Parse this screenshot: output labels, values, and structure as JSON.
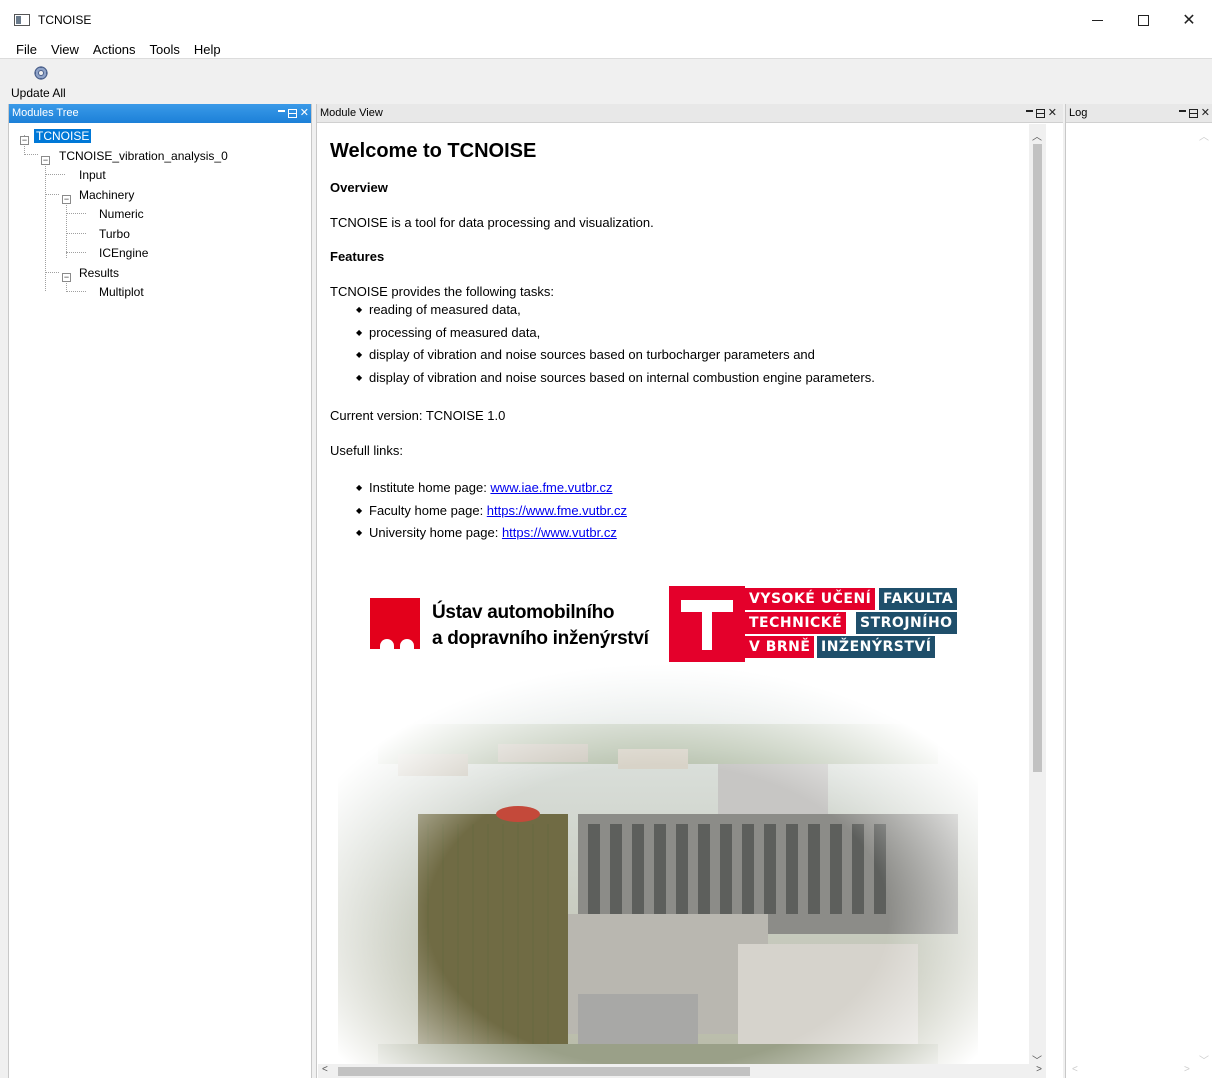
{
  "window": {
    "title": "TCNOISE",
    "minimize_icon": "minimize-icon",
    "maximize_icon": "maximize-icon",
    "close_glyph": "✕"
  },
  "menu": [
    "File",
    "View",
    "Actions",
    "Tools",
    "Help"
  ],
  "toolbar": {
    "update_all_label": "Update All",
    "update_icon": "gear-refresh-icon"
  },
  "panels": {
    "modules_tree_title": "Modules Tree",
    "module_view_title": "Module View",
    "log_title": "Log"
  },
  "tree": {
    "root": "TCNOISE",
    "analysis": "TCNOISE_vibration_analysis_0",
    "input": "Input",
    "machinery": "Machinery",
    "numeric": "Numeric",
    "turbo": "Turbo",
    "icengine": "ICEngine",
    "results": "Results",
    "multiplot": "Multiplot"
  },
  "content": {
    "heading": "Welcome to TCNOISE",
    "overview_heading": "Overview",
    "overview_text": "TCNOISE is a tool for data processing and visualization.",
    "features_heading": "Features",
    "features_intro": "TCNOISE provides the following tasks:",
    "features": [
      "reading of measured data,",
      "processing of measured data,",
      "display of vibration and noise sources based on turbocharger parameters and",
      "display of vibration and noise sources based on internal combustion engine parameters."
    ],
    "version_text": "Current version: TCNOISE 1.0",
    "links_heading": "Usefull links:",
    "links": [
      {
        "label": "Institute home page: ",
        "url_text": "www.iae.fme.vutbr.cz"
      },
      {
        "label": "Faculty home page: ",
        "url_text": "https://www.fme.vutbr.cz"
      },
      {
        "label": "University home page: ",
        "url_text": "https://www.vutbr.cz"
      }
    ]
  },
  "logos": {
    "iae_line1": "Ústav automobilního",
    "iae_line2": "a dopravního inženýrství",
    "vut_r1a": "VYSOKÉ UČENÍ",
    "vut_r1b": "FAKULTA",
    "vut_r2a": "TECHNICKÉ",
    "vut_r2b": "STROJNÍHO",
    "vut_r3a": "V BRNĚ",
    "vut_r3b": "INŽENÝRSTVÍ",
    "vut_red": "#e4002b",
    "vut_blue": "#1f4f6b"
  },
  "colors": {
    "selection": "#0078d7",
    "active_dock": "#1c80d8",
    "link": "#0000ee"
  }
}
